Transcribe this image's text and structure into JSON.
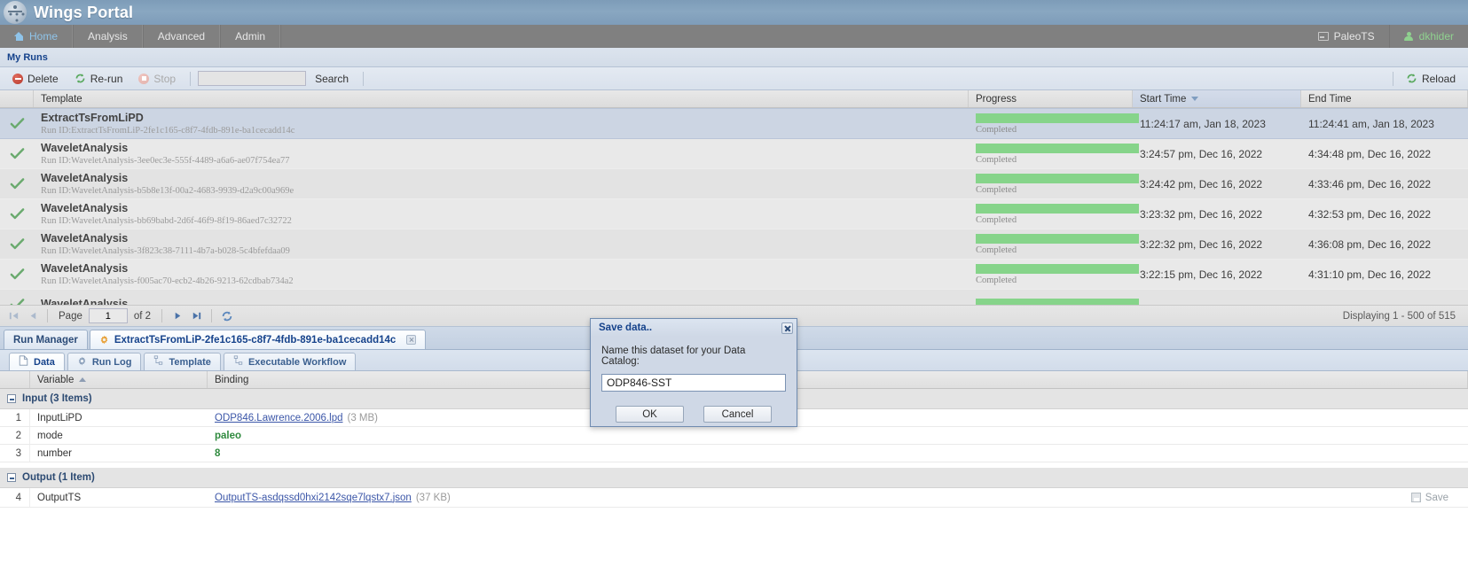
{
  "brand": {
    "title": "Wings Portal",
    "logo_icon": "wings-logo-icon"
  },
  "nav": {
    "items": [
      {
        "label": "Home",
        "icon": "home-icon",
        "active": true
      },
      {
        "label": "Analysis",
        "icon": "",
        "active": false
      },
      {
        "label": "Advanced",
        "icon": "",
        "active": false
      },
      {
        "label": "Admin",
        "icon": "",
        "active": false
      }
    ],
    "domain": {
      "label": "PaleoTS",
      "icon": "monitor-icon"
    },
    "user": {
      "label": "dkhider",
      "icon": "user-icon"
    }
  },
  "runs_panel": {
    "title": "My Runs",
    "toolbar": {
      "delete_label": "Delete",
      "delete_icon": "delete-circle-icon",
      "rerun_label": "Re-run",
      "rerun_icon": "refresh-icon",
      "stop_label": "Stop",
      "stop_icon": "stop-circle-icon",
      "search_value": "",
      "search_placeholder": "",
      "search_label": "Search",
      "reload_label": "Reload",
      "reload_icon": "refresh-icon"
    },
    "columns": {
      "template": "Template",
      "progress": "Progress",
      "start_time": "Start Time",
      "end_time": "End Time",
      "sorted_column": "Start Time"
    },
    "rows": [
      {
        "template": "ExtractTsFromLiPD",
        "run_id": "Run ID:ExtractTsFromLiP-2fe1c165-c8f7-4fdb-891e-ba1cecadd14c",
        "status": "Completed",
        "progress": 100,
        "start_time": "11:24:17 am, Jan 18, 2023",
        "end_time": "11:24:41 am, Jan 18, 2023",
        "selected": true
      },
      {
        "template": "WaveletAnalysis",
        "run_id": "Run ID:WaveletAnalysis-3ee0ec3e-555f-4489-a6a6-ae07f754ea77",
        "status": "Completed",
        "progress": 100,
        "start_time": "3:24:57 pm, Dec 16, 2022",
        "end_time": "4:34:48 pm, Dec 16, 2022",
        "selected": false
      },
      {
        "template": "WaveletAnalysis",
        "run_id": "Run ID:WaveletAnalysis-b5b8e13f-00a2-4683-9939-d2a9c00a969e",
        "status": "Completed",
        "progress": 100,
        "start_time": "3:24:42 pm, Dec 16, 2022",
        "end_time": "4:33:46 pm, Dec 16, 2022",
        "selected": false
      },
      {
        "template": "WaveletAnalysis",
        "run_id": "Run ID:WaveletAnalysis-bb69babd-2d6f-46f9-8f19-86aed7c32722",
        "status": "Completed",
        "progress": 100,
        "start_time": "3:23:32 pm, Dec 16, 2022",
        "end_time": "4:32:53 pm, Dec 16, 2022",
        "selected": false
      },
      {
        "template": "WaveletAnalysis",
        "run_id": "Run ID:WaveletAnalysis-3f823c38-7111-4b7a-b028-5c4bfefdaa09",
        "status": "Completed",
        "progress": 100,
        "start_time": "3:22:32 pm, Dec 16, 2022",
        "end_time": "4:36:08 pm, Dec 16, 2022",
        "selected": false
      },
      {
        "template": "WaveletAnalysis",
        "run_id": "Run ID:WaveletAnalysis-f005ac70-ecb2-4b26-9213-62cdbab734a2",
        "status": "Completed",
        "progress": 100,
        "start_time": "3:22:15 pm, Dec 16, 2022",
        "end_time": "4:31:10 pm, Dec 16, 2022",
        "selected": false
      },
      {
        "template": "WaveletAnalysis",
        "run_id": "",
        "status": "",
        "progress": 100,
        "start_time": "",
        "end_time": "",
        "selected": false
      }
    ],
    "pager": {
      "first_icon": "first-page-icon",
      "prev_icon": "prev-page-icon",
      "page_label": "Page",
      "page_value": "1",
      "of_label": "of 2",
      "next_icon": "next-page-icon",
      "last_icon": "last-page-icon",
      "refresh_icon": "refresh-icon",
      "display_info": "Displaying 1 - 500 of 515"
    }
  },
  "workspace": {
    "main_tabs": [
      {
        "label": "Run Manager",
        "icon": "",
        "active": false,
        "closable": false
      },
      {
        "label": "ExtractTsFromLiP-2fe1c165-c8f7-4fdb-891e-ba1cecadd14c",
        "icon": "gear-icon",
        "active": true,
        "closable": true
      }
    ],
    "sub_tabs": [
      {
        "label": "Data",
        "icon": "document-icon",
        "active": true
      },
      {
        "label": "Run Log",
        "icon": "gear-icon",
        "active": false
      },
      {
        "label": "Template",
        "icon": "workflow-icon",
        "active": false
      },
      {
        "label": "Executable Workflow",
        "icon": "workflow-icon",
        "active": false
      }
    ],
    "table": {
      "columns": {
        "number": "",
        "variable": "Variable",
        "binding": "Binding",
        "sorted_column": "Variable"
      },
      "groups": [
        {
          "label": "Input (3 Items)",
          "rows": [
            {
              "num": "1",
              "variable": "InputLiPD",
              "binding_link": "ODP846.Lawrence.2006.lpd",
              "binding_size": "(3 MB)",
              "binding_value": "",
              "save_label": ""
            },
            {
              "num": "2",
              "variable": "mode",
              "binding_link": "",
              "binding_size": "",
              "binding_value": "paleo",
              "save_label": ""
            },
            {
              "num": "3",
              "variable": "number",
              "binding_link": "",
              "binding_size": "",
              "binding_value": "8",
              "save_label": ""
            }
          ]
        },
        {
          "label": "Output (1 Item)",
          "rows": [
            {
              "num": "4",
              "variable": "OutputTS",
              "binding_link": "OutputTS-asdqssd0hxi2142sqe7lqstx7.json",
              "binding_size": "(37 KB)",
              "binding_value": "",
              "save_label": "Save"
            }
          ]
        }
      ]
    }
  },
  "modal": {
    "title": "Save data..",
    "close_icon": "close-icon",
    "prompt": "Name this dataset for your Data Catalog:",
    "input_value": "ODP846-SST",
    "input_placeholder": "",
    "ok_label": "OK",
    "cancel_label": "Cancel"
  },
  "colors": {
    "brand_bar": "#89a7c1",
    "nav_bar": "#808080",
    "nav_active": "#8fc4ea",
    "user_green": "#8fd18f",
    "progress_green": "#86d48a",
    "panel_title": "#15428b",
    "link": "#3b56a8",
    "value_green": "#2f8a3e",
    "selected_row": "#ccd5e3"
  }
}
